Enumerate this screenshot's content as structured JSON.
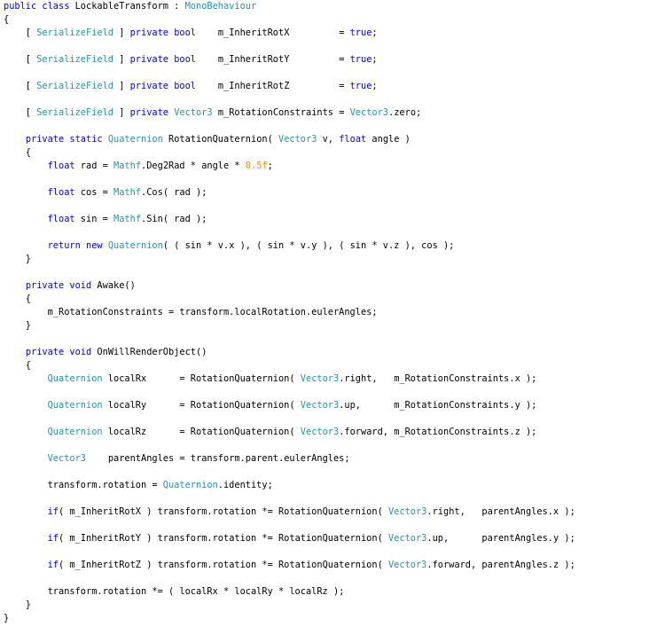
{
  "code": {
    "colors": {
      "kw": "#0000ff",
      "type": "#2b91af",
      "num": "#ff8c00",
      "plain": "#000000"
    },
    "lines": [
      {
        "row": 0,
        "tokens": [
          [
            "kw",
            "public class "
          ],
          [
            "plain",
            "LockableTransform : "
          ],
          [
            "type",
            "MonoBehaviour"
          ]
        ]
      },
      {
        "row": 1,
        "tokens": [
          [
            "plain",
            "{"
          ]
        ]
      },
      {
        "row": 2,
        "tokens": [
          [
            "plain",
            "    [ "
          ],
          [
            "type",
            "SerializeField"
          ],
          [
            "plain",
            " ] "
          ],
          [
            "kw",
            "private bool"
          ],
          [
            "plain",
            "    m_InheritRotX         = "
          ],
          [
            "kw",
            "true"
          ],
          [
            "plain",
            ";"
          ]
        ]
      },
      {
        "row": 4,
        "tokens": [
          [
            "plain",
            "    [ "
          ],
          [
            "type",
            "SerializeField"
          ],
          [
            "plain",
            " ] "
          ],
          [
            "kw",
            "private bool"
          ],
          [
            "plain",
            "    m_InheritRotY         = "
          ],
          [
            "kw",
            "true"
          ],
          [
            "plain",
            ";"
          ]
        ]
      },
      {
        "row": 6,
        "tokens": [
          [
            "plain",
            "    [ "
          ],
          [
            "type",
            "SerializeField"
          ],
          [
            "plain",
            " ] "
          ],
          [
            "kw",
            "private bool"
          ],
          [
            "plain",
            "    m_InheritRotZ         = "
          ],
          [
            "kw",
            "true"
          ],
          [
            "plain",
            ";"
          ]
        ]
      },
      {
        "row": 8,
        "tokens": [
          [
            "plain",
            "    [ "
          ],
          [
            "type",
            "SerializeField"
          ],
          [
            "plain",
            " ] "
          ],
          [
            "kw",
            "private "
          ],
          [
            "type",
            "Vector3"
          ],
          [
            "plain",
            " m_RotationConstraints = "
          ],
          [
            "type",
            "Vector3"
          ],
          [
            "plain",
            ".zero;"
          ]
        ]
      },
      {
        "row": 10,
        "tokens": [
          [
            "plain",
            "    "
          ],
          [
            "kw",
            "private static "
          ],
          [
            "type",
            "Quaternion"
          ],
          [
            "plain",
            " RotationQuaternion( "
          ],
          [
            "type",
            "Vector3"
          ],
          [
            "plain",
            " v, "
          ],
          [
            "kw",
            "float"
          ],
          [
            "plain",
            " angle )"
          ]
        ]
      },
      {
        "row": 11,
        "tokens": [
          [
            "plain",
            "    {"
          ]
        ]
      },
      {
        "row": 12,
        "tokens": [
          [
            "plain",
            "        "
          ],
          [
            "kw",
            "float"
          ],
          [
            "plain",
            " rad = "
          ],
          [
            "type",
            "Mathf"
          ],
          [
            "plain",
            ".Deg2Rad * angle * "
          ],
          [
            "num",
            "0.5f"
          ],
          [
            "plain",
            ";"
          ]
        ]
      },
      {
        "row": 14,
        "tokens": [
          [
            "plain",
            "        "
          ],
          [
            "kw",
            "float"
          ],
          [
            "plain",
            " cos = "
          ],
          [
            "type",
            "Mathf"
          ],
          [
            "plain",
            ".Cos( rad );"
          ]
        ]
      },
      {
        "row": 16,
        "tokens": [
          [
            "plain",
            "        "
          ],
          [
            "kw",
            "float"
          ],
          [
            "plain",
            " sin = "
          ],
          [
            "type",
            "Mathf"
          ],
          [
            "plain",
            ".Sin( rad );"
          ]
        ]
      },
      {
        "row": 18,
        "tokens": [
          [
            "plain",
            "        "
          ],
          [
            "kw",
            "return new "
          ],
          [
            "type",
            "Quaternion"
          ],
          [
            "plain",
            "( ( sin * v.x ), ( sin * v.y ), ( sin * v.z ), cos );"
          ]
        ]
      },
      {
        "row": 19,
        "tokens": [
          [
            "plain",
            "    }"
          ]
        ]
      },
      {
        "row": 21,
        "tokens": [
          [
            "plain",
            "    "
          ],
          [
            "kw",
            "private void"
          ],
          [
            "plain",
            " Awake()"
          ]
        ]
      },
      {
        "row": 22,
        "tokens": [
          [
            "plain",
            "    {"
          ]
        ]
      },
      {
        "row": 23,
        "tokens": [
          [
            "plain",
            "        m_RotationConstraints = transform.localRotation.eulerAngles;"
          ]
        ]
      },
      {
        "row": 24,
        "tokens": [
          [
            "plain",
            "    }"
          ]
        ]
      },
      {
        "row": 26,
        "tokens": [
          [
            "plain",
            "    "
          ],
          [
            "kw",
            "private void"
          ],
          [
            "plain",
            " OnWillRenderObject()"
          ]
        ]
      },
      {
        "row": 27,
        "tokens": [
          [
            "plain",
            "    {"
          ]
        ]
      },
      {
        "row": 28,
        "tokens": [
          [
            "plain",
            "        "
          ],
          [
            "type",
            "Quaternion"
          ],
          [
            "plain",
            " localRx      = RotationQuaternion( "
          ],
          [
            "type",
            "Vector3"
          ],
          [
            "plain",
            ".right,   m_RotationConstraints.x );"
          ]
        ]
      },
      {
        "row": 30,
        "tokens": [
          [
            "plain",
            "        "
          ],
          [
            "type",
            "Quaternion"
          ],
          [
            "plain",
            " localRy      = RotationQuaternion( "
          ],
          [
            "type",
            "Vector3"
          ],
          [
            "plain",
            ".up,      m_RotationConstraints.y );"
          ]
        ]
      },
      {
        "row": 32,
        "tokens": [
          [
            "plain",
            "        "
          ],
          [
            "type",
            "Quaternion"
          ],
          [
            "plain",
            " localRz      = RotationQuaternion( "
          ],
          [
            "type",
            "Vector3"
          ],
          [
            "plain",
            ".forward, m_RotationConstraints.z );"
          ]
        ]
      },
      {
        "row": 34,
        "tokens": [
          [
            "plain",
            "        "
          ],
          [
            "type",
            "Vector3"
          ],
          [
            "plain",
            "    parentAngles = transform.parent.eulerAngles;"
          ]
        ]
      },
      {
        "row": 36,
        "tokens": [
          [
            "plain",
            "        transform.rotation = "
          ],
          [
            "type",
            "Quaternion"
          ],
          [
            "plain",
            ".identity;"
          ]
        ]
      },
      {
        "row": 38,
        "tokens": [
          [
            "plain",
            "        "
          ],
          [
            "kw",
            "if"
          ],
          [
            "plain",
            "( m_InheritRotX ) transform.rotation *= RotationQuaternion( "
          ],
          [
            "type",
            "Vector3"
          ],
          [
            "plain",
            ".right,   parentAngles.x );"
          ]
        ]
      },
      {
        "row": 40,
        "tokens": [
          [
            "plain",
            "        "
          ],
          [
            "kw",
            "if"
          ],
          [
            "plain",
            "( m_InheritRotY ) transform.rotation *= RotationQuaternion( "
          ],
          [
            "type",
            "Vector3"
          ],
          [
            "plain",
            ".up,      parentAngles.y );"
          ]
        ]
      },
      {
        "row": 42,
        "tokens": [
          [
            "plain",
            "        "
          ],
          [
            "kw",
            "if"
          ],
          [
            "plain",
            "( m_InheritRotZ ) transform.rotation *= RotationQuaternion( "
          ],
          [
            "type",
            "Vector3"
          ],
          [
            "plain",
            ".forward, parentAngles.z );"
          ]
        ]
      },
      {
        "row": 44,
        "tokens": [
          [
            "plain",
            "        transform.rotation *= ( localRx * localRy * localRz );"
          ]
        ]
      },
      {
        "row": 45,
        "tokens": [
          [
            "plain",
            "    }"
          ]
        ]
      },
      {
        "row": 46,
        "tokens": [
          [
            "plain",
            "}"
          ]
        ]
      }
    ]
  }
}
